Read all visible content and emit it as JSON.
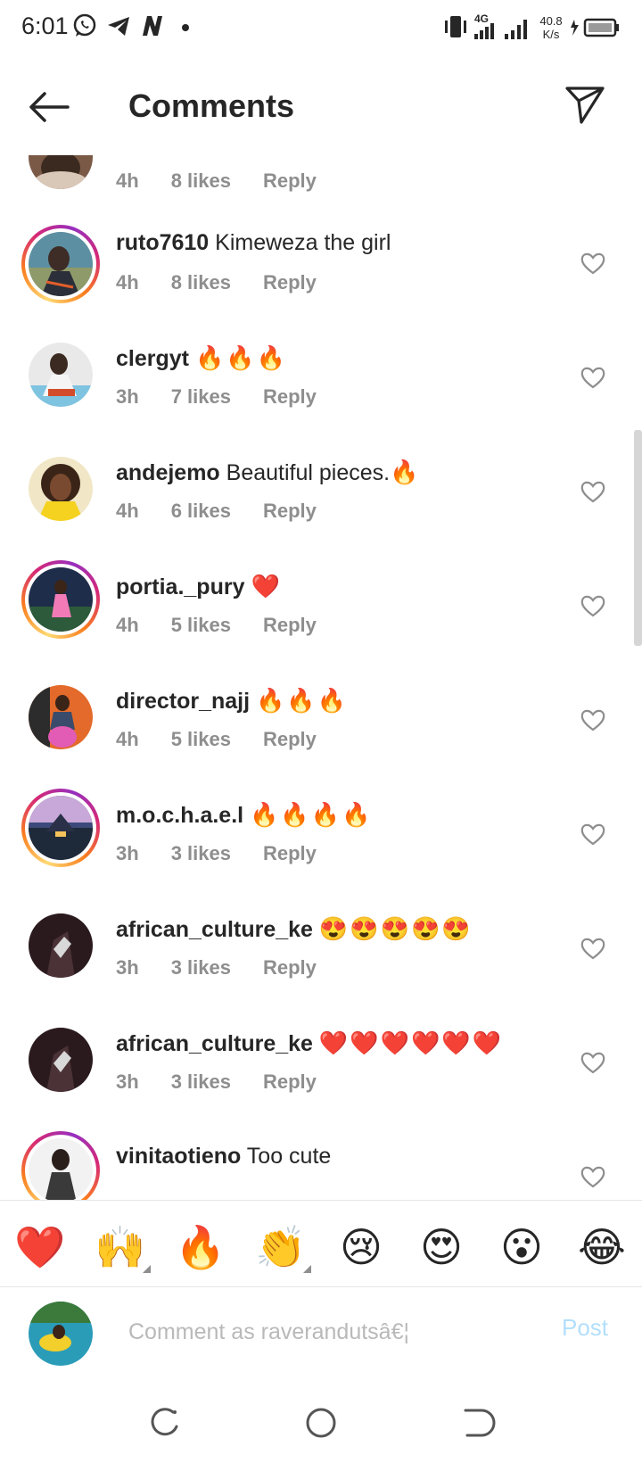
{
  "status_bar": {
    "time": "6:01",
    "network_type": "4G",
    "speed_value": "40.8",
    "speed_unit": "K/s",
    "icons": [
      "whatsapp-icon",
      "telegram-icon",
      "n-app-icon",
      "dot-icon",
      "vibrate-icon",
      "signal-4g-icon",
      "signal-icon",
      "battery-charging-icon"
    ]
  },
  "header": {
    "title": "Comments",
    "back_icon": "arrow-left-icon",
    "share_icon": "send-icon"
  },
  "comments": [
    {
      "username": "",
      "text": "",
      "emoji": "",
      "time": "4h",
      "likes": "8 likes",
      "reply": "Reply",
      "story_ring": false,
      "partial": true
    },
    {
      "username": "ruto7610",
      "text": "Kimeweza the girl",
      "emoji": "",
      "time": "4h",
      "likes": "8 likes",
      "reply": "Reply",
      "story_ring": true
    },
    {
      "username": "clergyt",
      "text": "",
      "emoji": "🔥🔥🔥",
      "time": "3h",
      "likes": "7 likes",
      "reply": "Reply",
      "story_ring": false
    },
    {
      "username": "andejemo",
      "text": "Beautiful pieces.",
      "emoji": "🔥",
      "time": "4h",
      "likes": "6 likes",
      "reply": "Reply",
      "story_ring": false
    },
    {
      "username": "portia._pury",
      "text": "",
      "emoji": "❤️",
      "time": "4h",
      "likes": "5 likes",
      "reply": "Reply",
      "story_ring": true
    },
    {
      "username": "director_najj",
      "text": "",
      "emoji": "🔥🔥🔥",
      "time": "4h",
      "likes": "5 likes",
      "reply": "Reply",
      "story_ring": false
    },
    {
      "username": "m.o.c.h.a.e.l",
      "text": "",
      "emoji": "🔥🔥🔥🔥",
      "time": "3h",
      "likes": "3 likes",
      "reply": "Reply",
      "story_ring": true
    },
    {
      "username": "african_culture_ke",
      "text": "",
      "emoji": "😍😍😍😍😍",
      "time": "3h",
      "likes": "3 likes",
      "reply": "Reply",
      "story_ring": false
    },
    {
      "username": "african_culture_ke",
      "text": "",
      "emoji": "❤️❤️❤️❤️❤️❤️",
      "time": "3h",
      "likes": "3 likes",
      "reply": "Reply",
      "story_ring": false
    },
    {
      "username": "vinitaotieno",
      "text": "Too cute",
      "emoji": "",
      "time": "",
      "likes": "",
      "reply": "",
      "story_ring": true,
      "partial": true
    }
  ],
  "emoji_bar": [
    "❤️",
    "🙌",
    "🔥",
    "👏",
    "😢",
    "😍",
    "😮",
    "😂"
  ],
  "composer": {
    "placeholder": "Comment as raverandutsâ€¦",
    "post_label": "Post"
  },
  "colors": {
    "text": "#262626",
    "secondary_text": "#8e8e8e",
    "post_disabled": "#b2dffc",
    "heart_outline": "#8e8e8e"
  },
  "nav_bar": [
    "recents-icon",
    "home-icon",
    "back-icon"
  ]
}
